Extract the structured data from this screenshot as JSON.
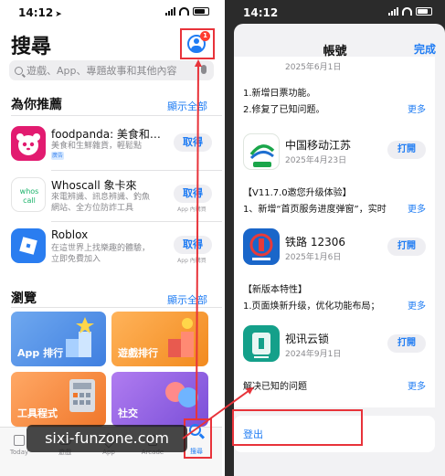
{
  "left": {
    "status": {
      "time": "14:12"
    },
    "title": "搜尋",
    "profile_badge": "1",
    "search_placeholder": "遊戲、App、專題故事和其他內容",
    "recommended": {
      "heading": "為你推薦",
      "see_all": "顯示全部",
      "apps": [
        {
          "name": "foodpanda: 美食和…",
          "sub1": "美食和生鮮雜貨，輕鬆點",
          "sub2": "",
          "badge": "廣告",
          "button": "取得",
          "inapp": "",
          "color": "#e21b70"
        },
        {
          "name": "Whoscall 象卡來",
          "sub1": "來電辨識、訊息辨識、釣魚",
          "sub2": "網站、全方位防詐工具",
          "badge": "",
          "button": "取得",
          "inapp": "App 內購買",
          "color": "#1bb36a"
        },
        {
          "name": "Roblox",
          "sub1": "在這世界上找樂趣的體驗，",
          "sub2": "立即免費加入",
          "badge": "",
          "button": "取得",
          "inapp": "App 內購買",
          "color": "#2a7df0"
        }
      ]
    },
    "browse": {
      "heading": "瀏覽",
      "see_all": "顯示全部",
      "tiles": [
        "App 排行",
        "遊戲排行",
        "工具程式",
        "社交"
      ]
    },
    "tabs": [
      "Today",
      "遊戲",
      "App",
      "Arcade",
      "搜尋"
    ]
  },
  "watermark": "sixi-funzone.com",
  "right": {
    "status": {
      "time": "14:12"
    },
    "sheet_title": "帳號",
    "done": "完成",
    "more": "更多",
    "top_date": "2025年6月1日",
    "top_notes": [
      "1.新增日票功能。",
      "2.修复了已知问题。"
    ],
    "updates": [
      {
        "name": "中国移动江苏",
        "date": "2025年4月23日",
        "button": "打開",
        "notes": [
          "【V11.7.0邀您升级体验】",
          "1、新增“首页服务进度弹窗”，实时"
        ],
        "color": "#1aa64a"
      },
      {
        "name": "铁路 12306",
        "date": "2025年1月6日",
        "button": "打開",
        "notes": [
          "【新版本特性】",
          "1.页面焕新升级，优化功能布局；"
        ],
        "color": "#1a66c9"
      },
      {
        "name": "视讯云锁",
        "date": "2024年9月1日",
        "button": "打開",
        "notes": [
          "解决已知的问题"
        ],
        "color": "#14a08a"
      }
    ],
    "logout": "登出"
  }
}
